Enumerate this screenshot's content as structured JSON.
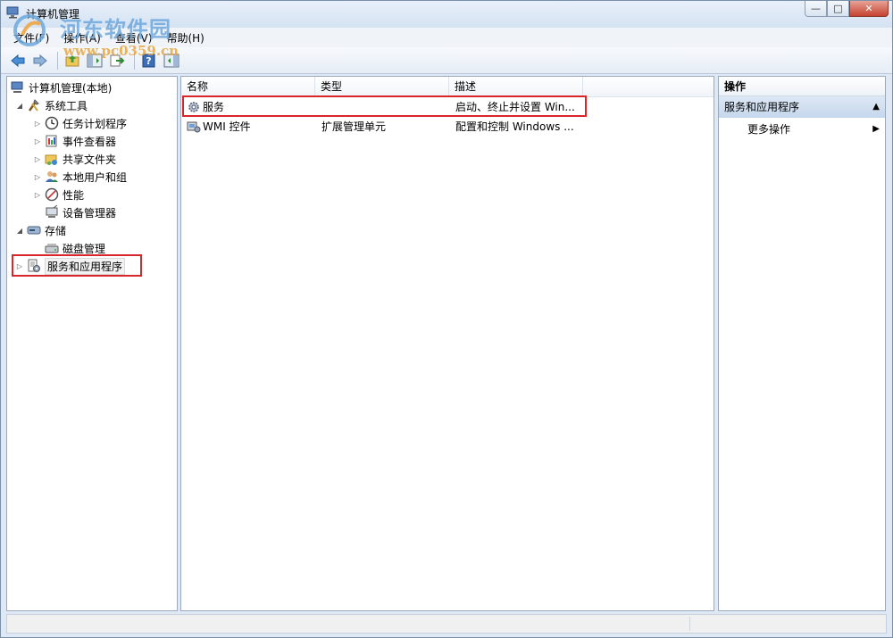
{
  "window": {
    "title": "计算机管理",
    "controls": {
      "minimize": "—",
      "maximize": "□",
      "close": "✕"
    }
  },
  "watermark": {
    "text": "河东软件园",
    "url": "www.pc0359.cn"
  },
  "menu": [
    "文件(F)",
    "操作(A)",
    "查看(V)",
    "帮助(H)"
  ],
  "toolbar": [
    "back-icon",
    "forward-icon",
    "up-folder-icon",
    "show-hide-tree-icon",
    "export-list-icon",
    "help-icon",
    "show-hide-action-pane-icon"
  ],
  "tree": {
    "root": "计算机管理(本地)",
    "items": [
      {
        "label": "系统工具",
        "icon": "tools-icon",
        "level": 1,
        "state": "expanded"
      },
      {
        "label": "任务计划程序",
        "icon": "clock-icon",
        "level": 2,
        "state": "collapsed"
      },
      {
        "label": "事件查看器",
        "icon": "event-viewer-icon",
        "level": 2,
        "state": "collapsed"
      },
      {
        "label": "共享文件夹",
        "icon": "shared-folder-icon",
        "level": 2,
        "state": "collapsed"
      },
      {
        "label": "本地用户和组",
        "icon": "users-icon",
        "level": 2,
        "state": "collapsed"
      },
      {
        "label": "性能",
        "icon": "performance-icon",
        "level": 2,
        "state": "collapsed"
      },
      {
        "label": "设备管理器",
        "icon": "device-manager-icon",
        "level": 2,
        "state": "leaf"
      },
      {
        "label": "存储",
        "icon": "storage-icon",
        "level": 1,
        "state": "expanded"
      },
      {
        "label": "磁盘管理",
        "icon": "disk-icon",
        "level": 2,
        "state": "leaf"
      },
      {
        "label": "服务和应用程序",
        "icon": "services-apps-icon",
        "level": 1,
        "state": "collapsed",
        "selected": true
      }
    ]
  },
  "list": {
    "columns": [
      "名称",
      "类型",
      "描述"
    ],
    "rows": [
      {
        "name": "服务",
        "type": "",
        "description": "启动、终止并设置 Win...",
        "icon": "services-gear-icon"
      },
      {
        "name": "WMI 控件",
        "type": "扩展管理单元",
        "description": "配置和控制 Windows ...",
        "icon": "wmi-icon"
      }
    ]
  },
  "actions": {
    "header": "操作",
    "section": "服务和应用程序",
    "more": "更多操作"
  },
  "colors": {
    "highlight_border": "#d9262b",
    "window_bg": "#dfe9f5",
    "section_bg": "#c6d7ec"
  }
}
